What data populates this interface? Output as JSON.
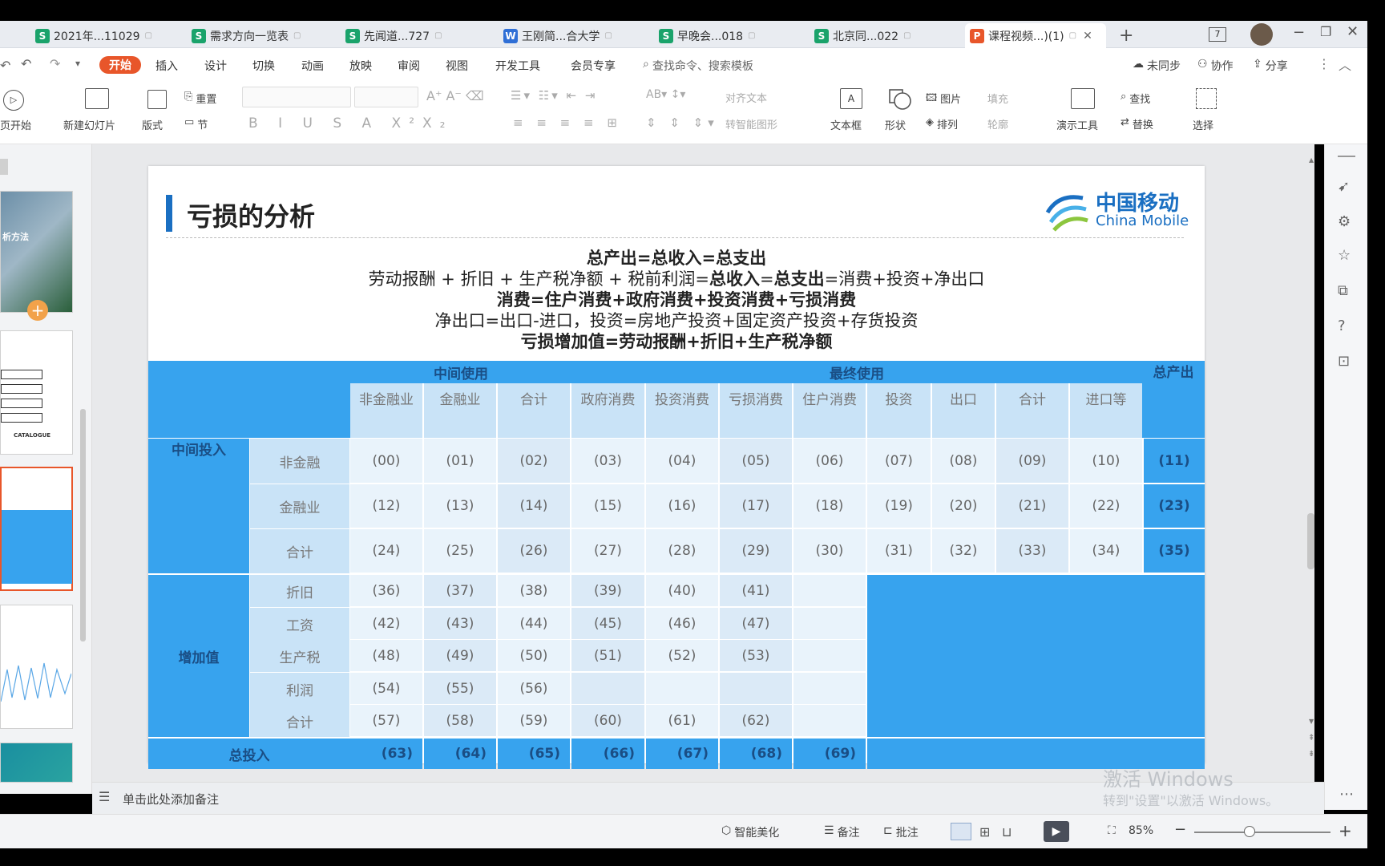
{
  "tabs": [
    {
      "icon": "S",
      "type": "s",
      "label": "2021年...11029"
    },
    {
      "icon": "S",
      "type": "s",
      "label": "需求方向一览表"
    },
    {
      "icon": "S",
      "type": "s",
      "label": "先闻道...727"
    },
    {
      "icon": "W",
      "type": "w",
      "label": "王刚简...合大学"
    },
    {
      "icon": "S",
      "type": "s",
      "label": "早晚会...018"
    },
    {
      "icon": "S",
      "type": "s",
      "label": "北京同...022"
    },
    {
      "icon": "P",
      "type": "p",
      "label": "课程视频...)(1)"
    }
  ],
  "tabbar": {
    "new_tab": "+",
    "page_count": "7"
  },
  "menu": {
    "start": "开始",
    "items": [
      "插入",
      "设计",
      "切换",
      "动画",
      "放映",
      "审阅",
      "视图",
      "开发工具",
      "会员专享"
    ],
    "search": "查找命令、搜索模板",
    "unsync": "未同步",
    "collab": "协作",
    "share": "分享"
  },
  "ribbon": {
    "play_from": "页开始",
    "new_slide": "新建幻灯片",
    "layout": "版式",
    "reset": "重置",
    "section": "节",
    "align_text": "对齐文本",
    "smart": "转智能图形",
    "textbox": "文本框",
    "shape": "形状",
    "arrange": "排列",
    "picture": "图片",
    "fill": "填充",
    "outline": "轮廓",
    "present_tools": "演示工具",
    "find": "查找",
    "replace": "替换",
    "select": "选择"
  },
  "thumbnail": {
    "title_text": "析方法",
    "catalogue": "CATALOGUE"
  },
  "slide": {
    "title": "亏损的分析",
    "brand_cn": "中国移动",
    "brand_en": "China Mobile",
    "eq1": "总产出=总收入=总支出",
    "eq2a": "劳动报酬 + 折旧 + 生产税净额 + 税前利润=",
    "eq2b": "总收入",
    "eq2c": "=",
    "eq2d": "总支出",
    "eq2e": "=消费+投资+净出口",
    "eq3": "消费=住户消费+政府消费+投资消费+亏损消费",
    "eq4": "净出口=出口-进口，投资=房地产投资+固定资产投资+存货投资",
    "eq5": "亏损增加值=劳动报酬+折旧+生产税净额"
  },
  "table": {
    "mid_use": "中间使用",
    "final_use": "最终使用",
    "total_output": "总产出",
    "cols": [
      "非金融业",
      "金融业",
      "合计",
      "政府消费",
      "投资消费",
      "亏损消费",
      "住户消费",
      "投资",
      "出口",
      "合计",
      "进口等"
    ],
    "mid_input": "中间投入",
    "mid_rows": [
      {
        "label": "非金融",
        "cells": [
          "(00)",
          "(01)",
          "(02)",
          "(03)",
          "(04)",
          "(05)",
          "(06)",
          "(07)",
          "(08)",
          "(09)",
          "(10)"
        ],
        "total": "(11)"
      },
      {
        "label": "金融业",
        "cells": [
          "(12)",
          "(13)",
          "(14)",
          "(15)",
          "(16)",
          "(17)",
          "(18)",
          "(19)",
          "(20)",
          "(21)",
          "(22)"
        ],
        "total": "(23)"
      },
      {
        "label": "合计",
        "cells": [
          "(24)",
          "(25)",
          "(26)",
          "(27)",
          "(28)",
          "(29)",
          "(30)",
          "(31)",
          "(32)",
          "(33)",
          "(34)"
        ],
        "total": "(35)"
      }
    ],
    "value_added": "增加值",
    "va_rows": [
      {
        "label": "折旧",
        "cells": [
          "(36)",
          "(37)",
          "(38)",
          "(39)",
          "(40)",
          "(41)",
          ""
        ]
      },
      {
        "label": "工资",
        "cells": [
          "(42)",
          "(43)",
          "(44)",
          "(45)",
          "(46)",
          "(47)",
          ""
        ]
      },
      {
        "label": "生产税",
        "cells": [
          "(48)",
          "(49)",
          "(50)",
          "(51)",
          "(52)",
          "(53)",
          ""
        ]
      },
      {
        "label": "利润",
        "cells": [
          "(54)",
          "(55)",
          "(56)",
          "",
          "",
          "",
          ""
        ]
      },
      {
        "label": "合计",
        "cells": [
          "(57)",
          "(58)",
          "(59)",
          "(60)",
          "(61)",
          "(62)",
          ""
        ]
      }
    ],
    "total_input": "总投入",
    "total_row": [
      "(63)",
      "(64)",
      "(65)",
      "(66)",
      "(67)",
      "(68)",
      "(69)"
    ]
  },
  "notes": {
    "add_note": "单击此处添加备注"
  },
  "watermark": {
    "line1": "激活 Windows",
    "line2": "转到\"设置\"以激活 Windows。"
  },
  "status": {
    "beautify": "智能美化",
    "note": "备注",
    "comment": "批注",
    "zoom": "85%",
    "minus": "−",
    "plus": "+"
  },
  "colors": {
    "accent": "#e8562a",
    "table_blue": "#37a3ee"
  }
}
